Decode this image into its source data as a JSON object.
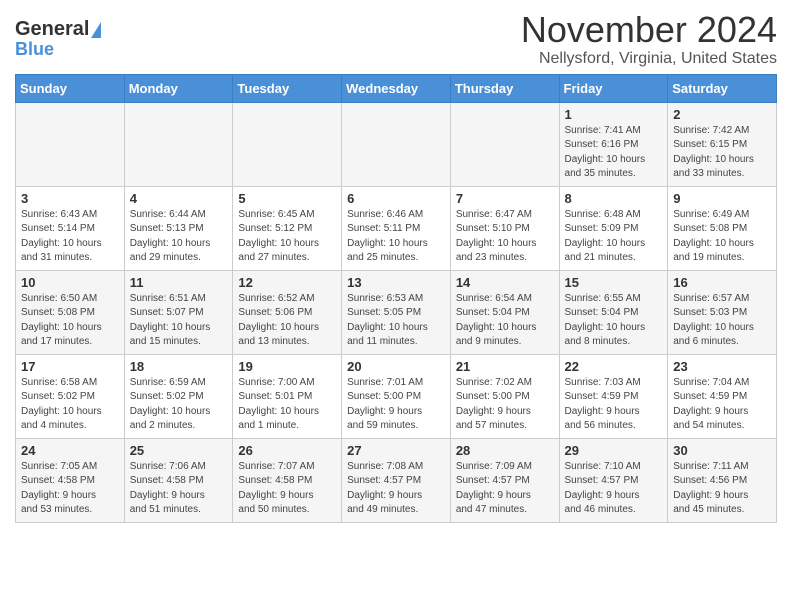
{
  "header": {
    "logo_line1": "General",
    "logo_line2": "Blue",
    "month": "November 2024",
    "location": "Nellysford, Virginia, United States"
  },
  "days_of_week": [
    "Sunday",
    "Monday",
    "Tuesday",
    "Wednesday",
    "Thursday",
    "Friday",
    "Saturday"
  ],
  "weeks": [
    [
      {
        "day": "",
        "info": ""
      },
      {
        "day": "",
        "info": ""
      },
      {
        "day": "",
        "info": ""
      },
      {
        "day": "",
        "info": ""
      },
      {
        "day": "",
        "info": ""
      },
      {
        "day": "1",
        "info": "Sunrise: 7:41 AM\nSunset: 6:16 PM\nDaylight: 10 hours\nand 35 minutes."
      },
      {
        "day": "2",
        "info": "Sunrise: 7:42 AM\nSunset: 6:15 PM\nDaylight: 10 hours\nand 33 minutes."
      }
    ],
    [
      {
        "day": "3",
        "info": "Sunrise: 6:43 AM\nSunset: 5:14 PM\nDaylight: 10 hours\nand 31 minutes."
      },
      {
        "day": "4",
        "info": "Sunrise: 6:44 AM\nSunset: 5:13 PM\nDaylight: 10 hours\nand 29 minutes."
      },
      {
        "day": "5",
        "info": "Sunrise: 6:45 AM\nSunset: 5:12 PM\nDaylight: 10 hours\nand 27 minutes."
      },
      {
        "day": "6",
        "info": "Sunrise: 6:46 AM\nSunset: 5:11 PM\nDaylight: 10 hours\nand 25 minutes."
      },
      {
        "day": "7",
        "info": "Sunrise: 6:47 AM\nSunset: 5:10 PM\nDaylight: 10 hours\nand 23 minutes."
      },
      {
        "day": "8",
        "info": "Sunrise: 6:48 AM\nSunset: 5:09 PM\nDaylight: 10 hours\nand 21 minutes."
      },
      {
        "day": "9",
        "info": "Sunrise: 6:49 AM\nSunset: 5:08 PM\nDaylight: 10 hours\nand 19 minutes."
      }
    ],
    [
      {
        "day": "10",
        "info": "Sunrise: 6:50 AM\nSunset: 5:08 PM\nDaylight: 10 hours\nand 17 minutes."
      },
      {
        "day": "11",
        "info": "Sunrise: 6:51 AM\nSunset: 5:07 PM\nDaylight: 10 hours\nand 15 minutes."
      },
      {
        "day": "12",
        "info": "Sunrise: 6:52 AM\nSunset: 5:06 PM\nDaylight: 10 hours\nand 13 minutes."
      },
      {
        "day": "13",
        "info": "Sunrise: 6:53 AM\nSunset: 5:05 PM\nDaylight: 10 hours\nand 11 minutes."
      },
      {
        "day": "14",
        "info": "Sunrise: 6:54 AM\nSunset: 5:04 PM\nDaylight: 10 hours\nand 9 minutes."
      },
      {
        "day": "15",
        "info": "Sunrise: 6:55 AM\nSunset: 5:04 PM\nDaylight: 10 hours\nand 8 minutes."
      },
      {
        "day": "16",
        "info": "Sunrise: 6:57 AM\nSunset: 5:03 PM\nDaylight: 10 hours\nand 6 minutes."
      }
    ],
    [
      {
        "day": "17",
        "info": "Sunrise: 6:58 AM\nSunset: 5:02 PM\nDaylight: 10 hours\nand 4 minutes."
      },
      {
        "day": "18",
        "info": "Sunrise: 6:59 AM\nSunset: 5:02 PM\nDaylight: 10 hours\nand 2 minutes."
      },
      {
        "day": "19",
        "info": "Sunrise: 7:00 AM\nSunset: 5:01 PM\nDaylight: 10 hours\nand 1 minute."
      },
      {
        "day": "20",
        "info": "Sunrise: 7:01 AM\nSunset: 5:00 PM\nDaylight: 9 hours\nand 59 minutes."
      },
      {
        "day": "21",
        "info": "Sunrise: 7:02 AM\nSunset: 5:00 PM\nDaylight: 9 hours\nand 57 minutes."
      },
      {
        "day": "22",
        "info": "Sunrise: 7:03 AM\nSunset: 4:59 PM\nDaylight: 9 hours\nand 56 minutes."
      },
      {
        "day": "23",
        "info": "Sunrise: 7:04 AM\nSunset: 4:59 PM\nDaylight: 9 hours\nand 54 minutes."
      }
    ],
    [
      {
        "day": "24",
        "info": "Sunrise: 7:05 AM\nSunset: 4:58 PM\nDaylight: 9 hours\nand 53 minutes."
      },
      {
        "day": "25",
        "info": "Sunrise: 7:06 AM\nSunset: 4:58 PM\nDaylight: 9 hours\nand 51 minutes."
      },
      {
        "day": "26",
        "info": "Sunrise: 7:07 AM\nSunset: 4:58 PM\nDaylight: 9 hours\nand 50 minutes."
      },
      {
        "day": "27",
        "info": "Sunrise: 7:08 AM\nSunset: 4:57 PM\nDaylight: 9 hours\nand 49 minutes."
      },
      {
        "day": "28",
        "info": "Sunrise: 7:09 AM\nSunset: 4:57 PM\nDaylight: 9 hours\nand 47 minutes."
      },
      {
        "day": "29",
        "info": "Sunrise: 7:10 AM\nSunset: 4:57 PM\nDaylight: 9 hours\nand 46 minutes."
      },
      {
        "day": "30",
        "info": "Sunrise: 7:11 AM\nSunset: 4:56 PM\nDaylight: 9 hours\nand 45 minutes."
      }
    ]
  ]
}
